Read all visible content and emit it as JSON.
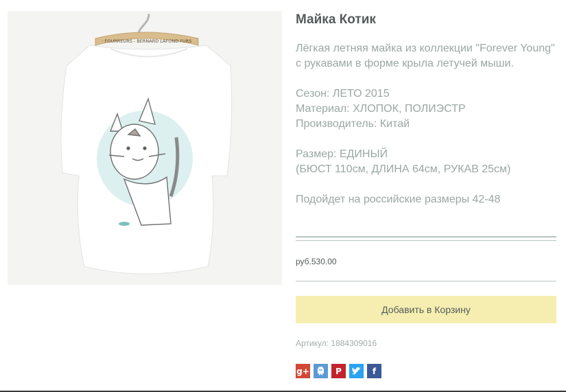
{
  "product": {
    "title": "Майка Котик",
    "description": [
      "Лёгкая летняя майка из коллекции \"Forever Young\" с рукавами в форме крыла летучей мыши."
    ],
    "specs": [
      "Сезон: ЛЕТО 2015",
      "Материал: ХЛОПОК, ПОЛИЭСТР",
      "Производитель: Китай"
    ],
    "size": [
      "Размер: ЕДИНЫЙ",
      "(БЮСТ 110см, ДЛИНА 64см, РУКАВ 25см)"
    ],
    "fit_note": "Подойдет на российские размеры 42-48",
    "price": "руб.530.00",
    "add_to_cart_label": "Добавить в Корзину",
    "sku": "Артикул: 1884309016",
    "hanger_text": "· FOURREURS - BERNARD LAFOND FURS"
  },
  "share": {
    "google_label": "g+",
    "pinterest_label": "P",
    "facebook_label": "f"
  },
  "colors": {
    "cart_button": "#f5eeb0",
    "text_muted": "#9aa8a4",
    "divider": "#b9c5c1"
  }
}
